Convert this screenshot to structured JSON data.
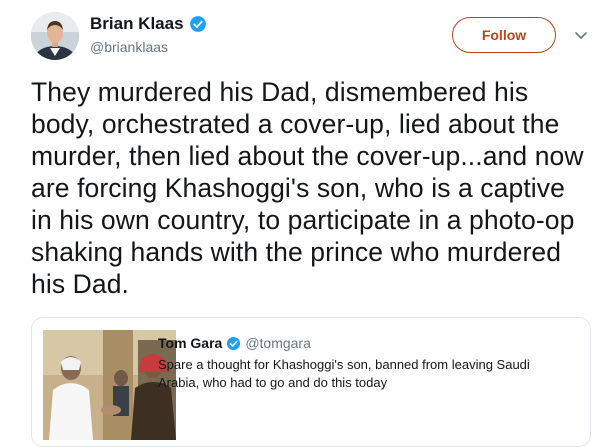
{
  "author": {
    "name": "Brian Klaas",
    "handle": "@brianklaas"
  },
  "actions": {
    "follow_label": "Follow"
  },
  "tweet": {
    "text": "They murdered his Dad, dismembered his body, orchestrated a cover-up, lied about the murder, then lied about the cover-up...and now are forcing Khashoggi's son, who is a captive in his own country, to participate in a photo-op shaking hands with the prince who murdered his Dad."
  },
  "quoted_tweet": {
    "name": "Tom Gara",
    "handle": "@tomgara",
    "text": "Spare a thought for Khashoggi's son, banned from leaving Saudi Arabia, who had to go and do this today"
  },
  "colors": {
    "accent": "#b5451b",
    "verified": "#1da1f2",
    "secondary_text": "#657786",
    "border": "#e1e8ed"
  },
  "icons": {
    "verified": "verified-badge-icon",
    "more": "chevron-down-icon"
  }
}
